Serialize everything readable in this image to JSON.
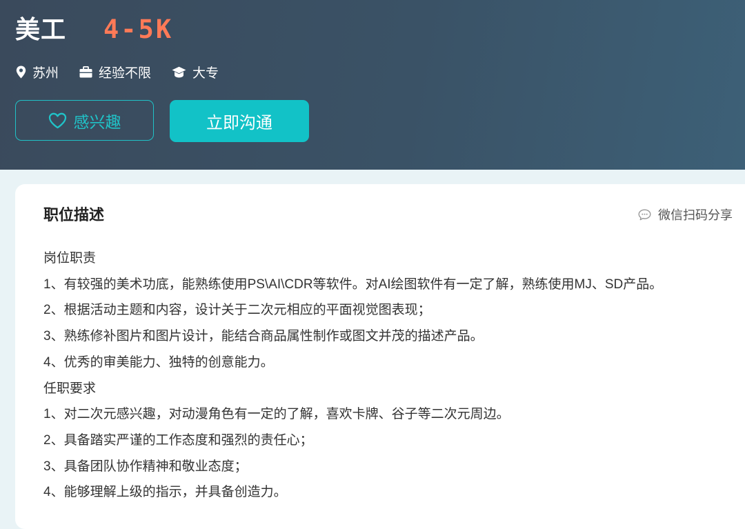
{
  "header": {
    "job_title": "美工",
    "salary": "4-5K",
    "location": "苏州",
    "experience": "经验不限",
    "education": "大专",
    "interest_label": "感兴趣",
    "chat_label": "立即沟通"
  },
  "description": {
    "title": "职位描述",
    "share_label": "微信扫码分享",
    "lines": [
      "岗位职责",
      "1、有较强的美术功底，能熟练使用PS\\AI\\CDR等软件。对AI绘图软件有一定了解，熟练使用MJ、SD产品。",
      "2、根据活动主题和内容，设计关于二次元相应的平面视觉图表现；",
      "3、熟练修补图片和图片设计，能结合商品属性制作或图文并茂的描述产品。",
      "4、优秀的审美能力、独特的创意能力。",
      "任职要求",
      "1、对二次元感兴趣，对动漫角色有一定的了解，喜欢卡牌、谷子等二次元周边。",
      "2、具备踏实严谨的工作态度和强烈的责任心；",
      "3、具备团队协作精神和敬业态度；",
      "4、能够理解上级的指示，并具备创造力。"
    ]
  },
  "colors": {
    "header_bg": "#3a5266",
    "accent": "#12c2c7",
    "salary": "#ff7a57"
  },
  "icons": [
    "location-pin-icon",
    "briefcase-icon",
    "graduation-cap-icon",
    "heart-icon",
    "chat-bubble-icon"
  ]
}
